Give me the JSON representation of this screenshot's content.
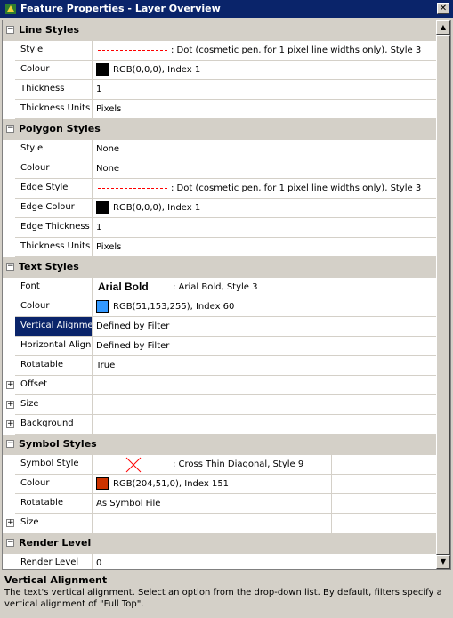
{
  "window": {
    "title": "Feature Properties - Layer Overview",
    "close_glyph": "✕"
  },
  "sections": [
    {
      "label": "Line Styles",
      "expanded": true,
      "props": [
        {
          "name": "Style",
          "value": ": Dot (cosmetic pen, for 1 pixel line widths only), Style 3",
          "kind": "line"
        },
        {
          "name": "Colour",
          "value": "RGB(0,0,0), Index 1",
          "kind": "color",
          "color": "#000000"
        },
        {
          "name": "Thickness",
          "value": "1"
        },
        {
          "name": "Thickness Units",
          "value": "Pixels"
        }
      ]
    },
    {
      "label": "Polygon Styles",
      "expanded": true,
      "props": [
        {
          "name": "Style",
          "value": "None"
        },
        {
          "name": "Colour",
          "value": "None"
        },
        {
          "name": "Edge Style",
          "value": ": Dot (cosmetic pen, for 1 pixel line widths only), Style 3",
          "kind": "line"
        },
        {
          "name": "Edge Colour",
          "value": "RGB(0,0,0), Index 1",
          "kind": "color",
          "color": "#000000"
        },
        {
          "name": "Edge Thickness",
          "value": "1"
        },
        {
          "name": "Thickness Units",
          "value": "Pixels"
        }
      ]
    },
    {
      "label": "Text Styles",
      "expanded": true,
      "props": [
        {
          "name": "Font",
          "value": ": Arial Bold, Style 3",
          "kind": "font",
          "sample": "Arial Bold"
        },
        {
          "name": "Colour",
          "value": "RGB(51,153,255), Index 60",
          "kind": "color",
          "color": "#3399ff"
        },
        {
          "name": "Vertical Alignment",
          "value": "Defined by Filter",
          "selected": true
        },
        {
          "name": "Horizontal Alignment",
          "value": "Defined by Filter"
        },
        {
          "name": "Rotatable",
          "value": "True"
        },
        {
          "name": "Offset",
          "value": "",
          "expander": true
        },
        {
          "name": "Size",
          "value": "",
          "expander": true
        },
        {
          "name": "Background",
          "value": "",
          "expander": true
        }
      ]
    },
    {
      "label": "Symbol Styles",
      "expanded": true,
      "props": [
        {
          "name": "Symbol Style",
          "value": ": Cross Thin Diagonal, Style 9",
          "kind": "symbol",
          "split": true
        },
        {
          "name": "Colour",
          "value": "RGB(204,51,0), Index 151",
          "kind": "color",
          "color": "#cc3300",
          "split": true
        },
        {
          "name": "Rotatable",
          "value": "As Symbol File",
          "split": true
        },
        {
          "name": "Size",
          "value": "",
          "expander": true,
          "split": true
        }
      ]
    },
    {
      "label": "Render Level",
      "expanded": true,
      "props": [
        {
          "name": "Render Level",
          "value": "0"
        }
      ]
    }
  ],
  "description": {
    "title": "Vertical Alignment",
    "body": "The text's vertical alignment.  Select an option from the drop-down list.  By default, filters specify a vertical alignment of \"Full Top\"."
  },
  "icons": {
    "expand_collapse": "minus",
    "expand": "plus",
    "scroll_up": "▲",
    "scroll_down": "▼"
  },
  "colors": {
    "title_bar": "#0a246a",
    "selection": "#0a246a",
    "line_style_red": "#ff0000",
    "symbol_red": "#ff0000"
  }
}
